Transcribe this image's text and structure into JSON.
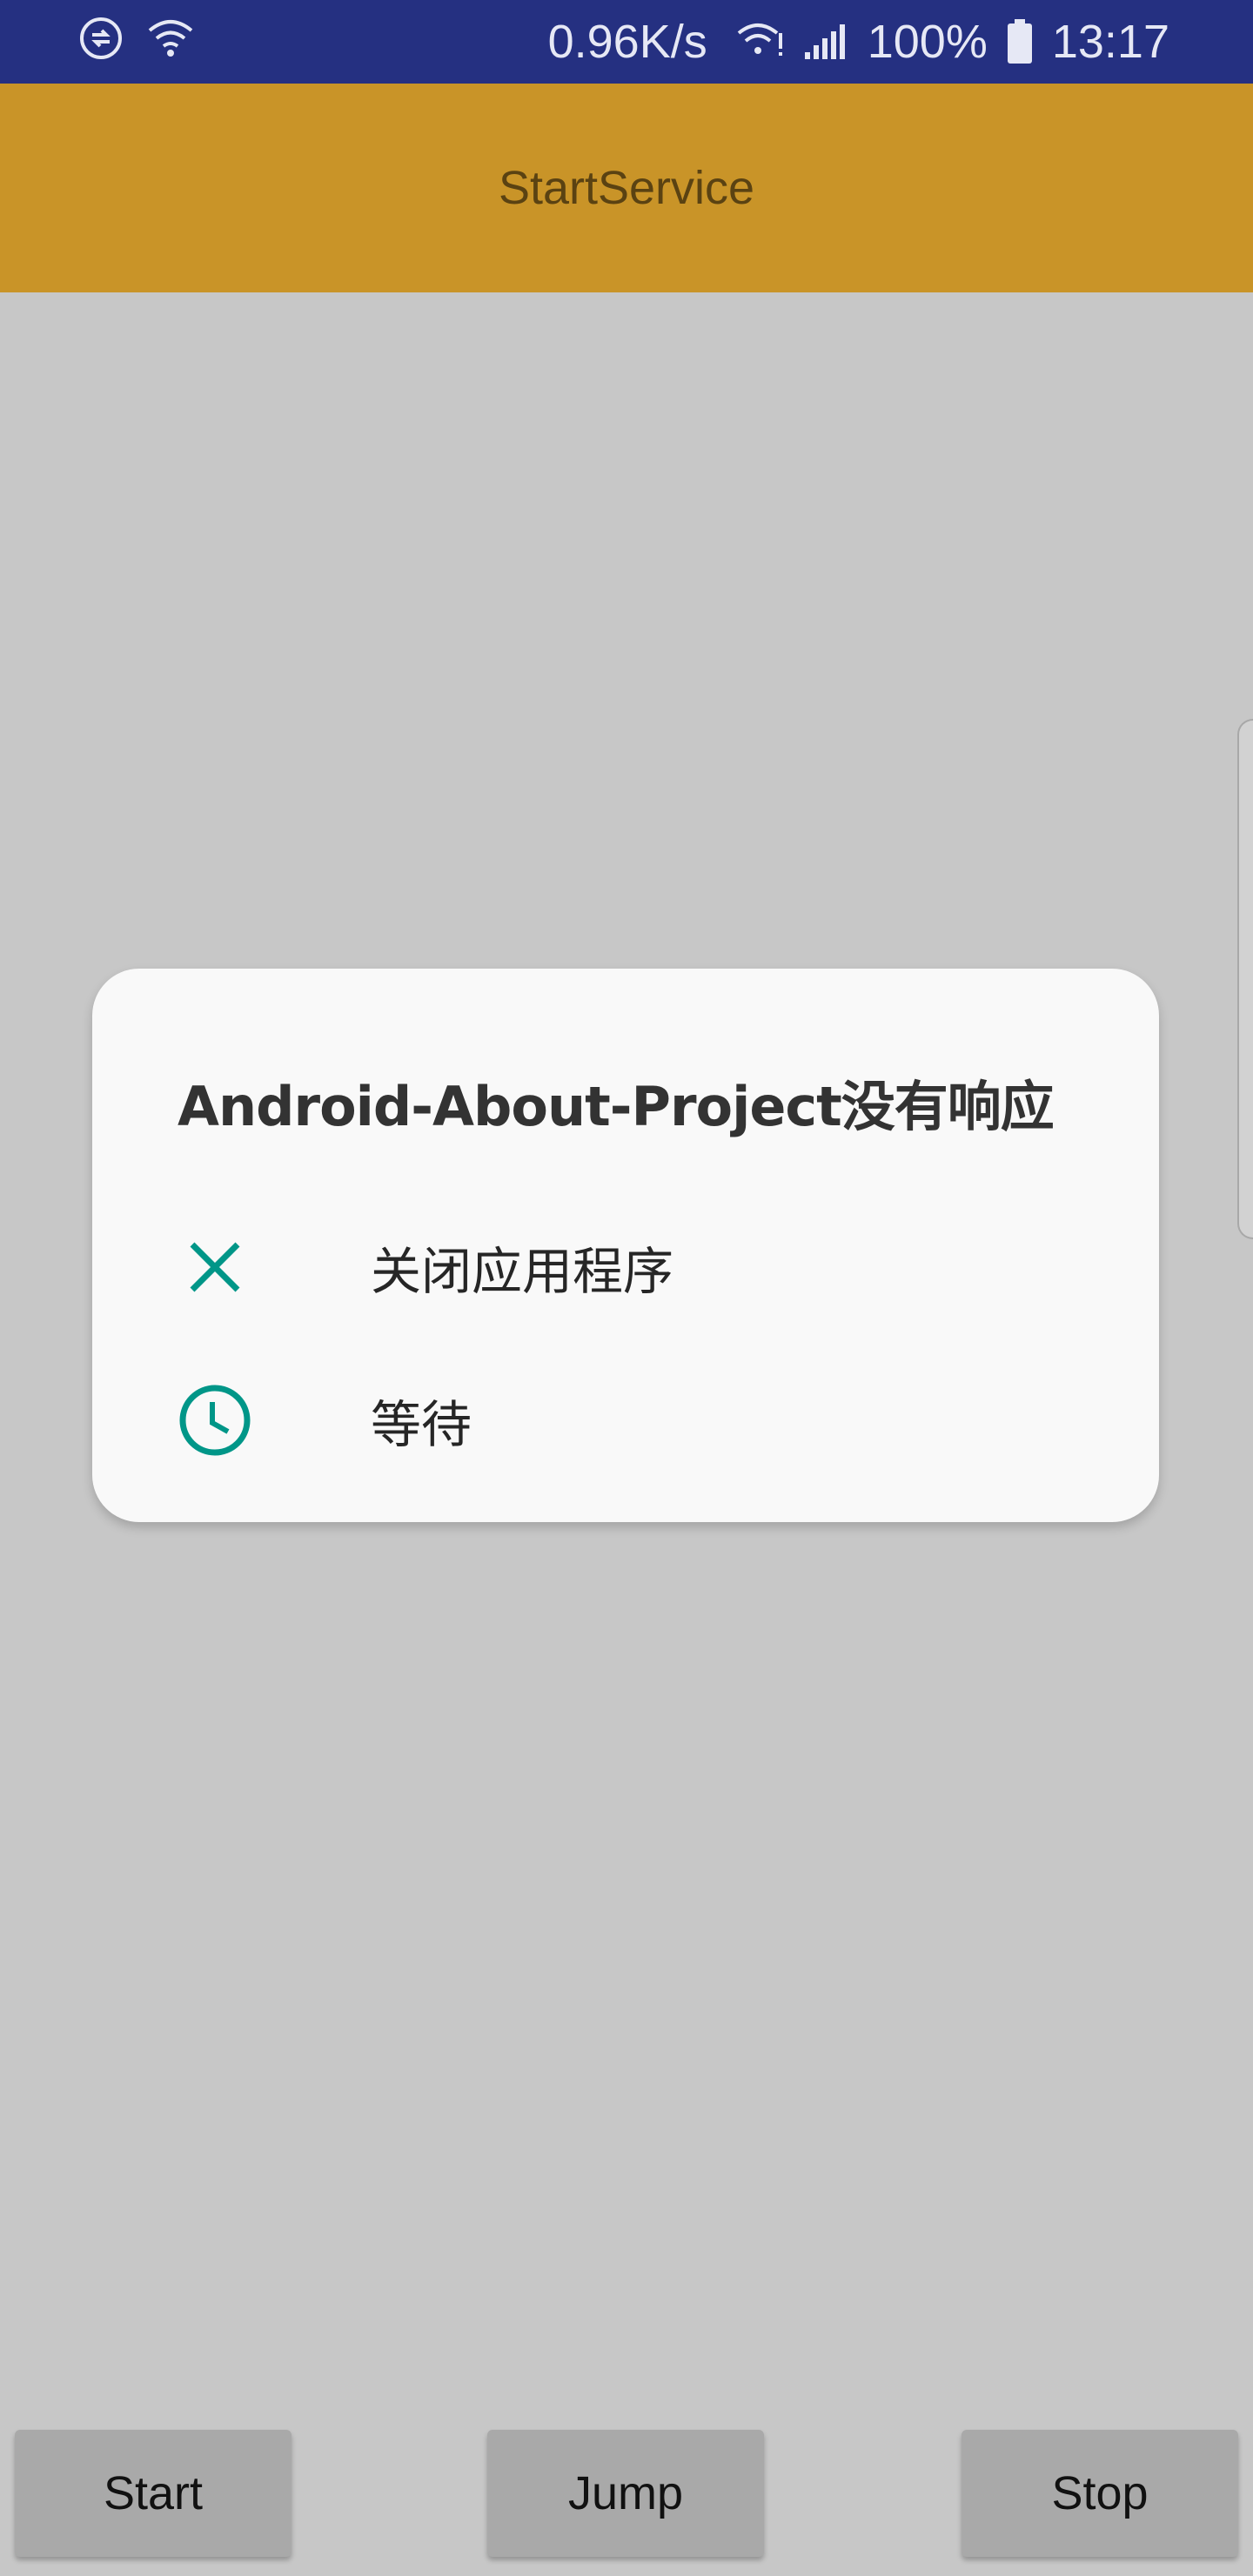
{
  "status_bar": {
    "net_speed": "0.96K/s",
    "battery": "100%",
    "time": "13:17",
    "icons": [
      "data-sync-icon",
      "wifi-icon",
      "wifi-signal-icon",
      "cell-signal-icon",
      "battery-icon"
    ]
  },
  "app_bar": {
    "title": "StartService"
  },
  "dialog": {
    "title": "Android-About-Project没有响应",
    "items": [
      {
        "label": "关闭应用程序",
        "icon": "close-icon"
      },
      {
        "label": "等待",
        "icon": "clock-icon"
      }
    ],
    "accent_color": "#009688"
  },
  "buttons": {
    "start": "Start",
    "jump": "Jump",
    "stop": "Stop"
  },
  "colors": {
    "status_bar": "#253081",
    "app_bar": "#c99428",
    "background": "#c7c7c7",
    "button": "#a9a9a9"
  }
}
